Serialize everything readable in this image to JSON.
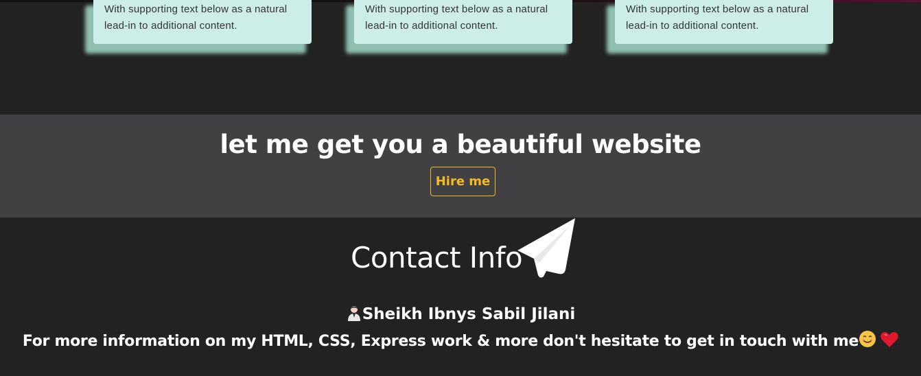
{
  "cards": [
    {
      "text": "With supporting text below as a natural lead-in to additional content."
    },
    {
      "text": "With supporting text below as a natural lead-in to additional content."
    },
    {
      "text": "With supporting text below as a natural lead-in to additional content."
    }
  ],
  "hire_section": {
    "headline": "let me get you a beautiful website",
    "button_label": "Hire me",
    "accent_color": "#f5b924"
  },
  "contact": {
    "title": "Contact Info",
    "title_icon": "paper-plane-icon",
    "name": "Sheikh Ibnys Sabil Jilani",
    "name_icon": "person-icon",
    "info": "For more information on my HTML, CSS, Express work & more don't hesitate to get in touch with me",
    "info_icons": [
      "smile-icon",
      "heart-icon"
    ]
  },
  "colors": {
    "background": "#222222",
    "band": "#414043",
    "card": "#cdeee8"
  }
}
